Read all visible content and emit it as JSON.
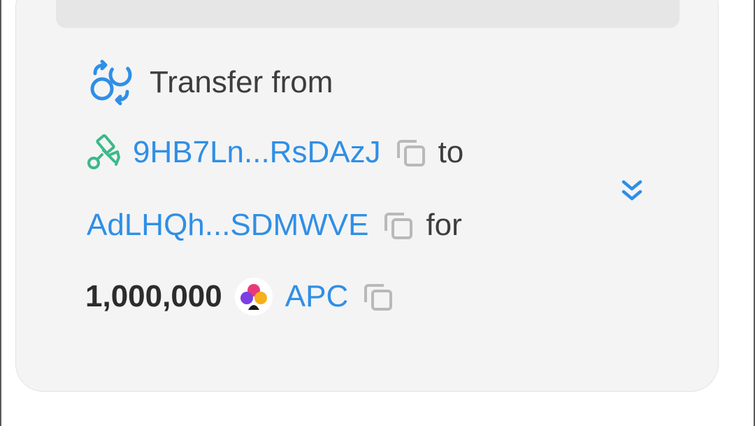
{
  "transfer": {
    "title": "Transfer from",
    "from_address": "9HB7Ln...RsDAzJ",
    "to_word": "to",
    "to_address": "AdLHQh...SDMWVE",
    "for_word": "for",
    "amount": "1,000,000",
    "token_symbol": "APC"
  },
  "icons": {
    "title": "transfer-swap-icon",
    "from_address": "tools-icon",
    "copy": "copy-icon",
    "token": "apc-token-logo",
    "expand": "chevron-double-down-icon"
  },
  "colors": {
    "accent_blue": "#2f8fe6",
    "green_icon": "#3cb98a",
    "text_dark": "#3d3d3d",
    "card_bg": "#f4f4f4"
  }
}
